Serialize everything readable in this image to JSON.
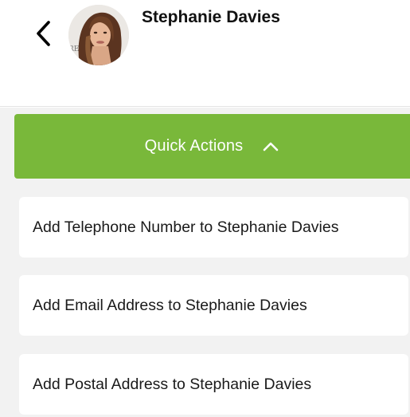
{
  "header": {
    "back_icon": "chevron-left-icon",
    "contact_name": "Stephanie Davies",
    "avatar_icon": "contact-photo"
  },
  "quick_actions": {
    "label": "Quick Actions",
    "toggle_icon": "chevron-up-icon",
    "color": "#79b83a"
  },
  "actions": [
    {
      "label": "Add Telephone Number to Stephanie Davies"
    },
    {
      "label": "Add Email Address to Stephanie Davies"
    },
    {
      "label": "Add Postal Address to Stephanie Davies"
    }
  ]
}
